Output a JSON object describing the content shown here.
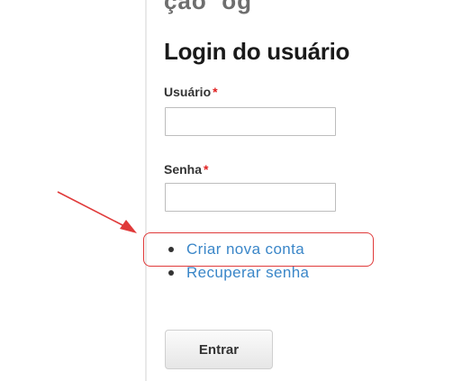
{
  "login": {
    "title": "Login do usuário",
    "username_label": "Usuário",
    "password_label": "Senha",
    "required_marker": "*",
    "username_value": "",
    "password_value": "",
    "submit_label": "Entrar"
  },
  "links": [
    {
      "label": "Criar nova conta",
      "highlighted": true
    },
    {
      "label": "Recuperar senha",
      "highlighted": false
    }
  ],
  "annotation": {
    "highlight_color": "#e03a3a",
    "arrow_color": "#e03a3a"
  },
  "colors": {
    "link": "#3a86c8",
    "required": "#e02020",
    "title": "#1a1a1a"
  }
}
